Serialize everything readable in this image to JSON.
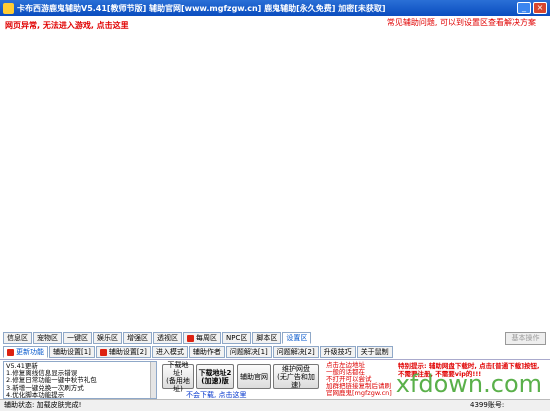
{
  "window": {
    "title": "卡布西游鹿鬼辅助V5.41[教师节版]  辅助官网[www.mgfzgw.cn]  鹿鬼辅助[永久免费]  加密[未获取]"
  },
  "content": {
    "net_error": "网页异常, 无法进入游戏, 点击这里",
    "top_right_note": "常见辅助问题, 可以到设置区查看解决方案",
    "basic_op": "基本操作"
  },
  "tabs_row1": [
    {
      "label": "信息区",
      "icon": false
    },
    {
      "label": "宠物区",
      "icon": false
    },
    {
      "label": "一键区",
      "icon": false
    },
    {
      "label": "娱乐区",
      "icon": false
    },
    {
      "label": "增强区",
      "icon": false
    },
    {
      "label": "透视区",
      "icon": false
    },
    {
      "label": "每周区",
      "icon": true
    },
    {
      "label": "NPC区",
      "icon": false
    },
    {
      "label": "脚本区",
      "icon": false
    },
    {
      "label": "设置区",
      "icon": false,
      "active": true
    }
  ],
  "tabs_row2": [
    {
      "label": "更新功能",
      "icon": true,
      "active": true
    },
    {
      "label": "辅助设置[1]",
      "icon": false
    },
    {
      "label": "辅助设置[2]",
      "icon": true
    },
    {
      "label": "进入模式",
      "icon": false
    },
    {
      "label": "辅助作者",
      "icon": false
    },
    {
      "label": "问题解决[1]",
      "icon": false
    },
    {
      "label": "问题解决[2]",
      "icon": false
    },
    {
      "label": "升级技巧",
      "icon": false
    },
    {
      "label": "关于鼠制",
      "icon": false
    }
  ],
  "notes": [
    "V5.41更新",
    "1.修复离线信息显示错误",
    "2.修复日常功能一键中秋节礼包",
    "3.新增一键兑换一次刷方式",
    "4.优化脚本功能提示"
  ],
  "buttons": {
    "download_fail": "下载地址!\n(备用地址)",
    "download_slow": "下载地址2\n(加速)版",
    "official": "辅助官网",
    "pan": "维护网盘\n(无广告和加速)"
  },
  "no_download_link": "不会下载, 点击这里",
  "mid_notes": [
    "点击左边地址",
    "一般的话都在",
    "不打开可以尝试",
    "加群把链接复制后请刷",
    "官网鹿鬼[mgfzgw.cn]"
  ],
  "right_notes": "特别提示: 辅助网盘下载时, 点击[普通下载]按钮, 不需要注册, 不需要vip的!!!",
  "status": {
    "text": "辅助状态: 加载皮肤完成!",
    "account": "4399账号:"
  },
  "watermark": "xfdown.com"
}
